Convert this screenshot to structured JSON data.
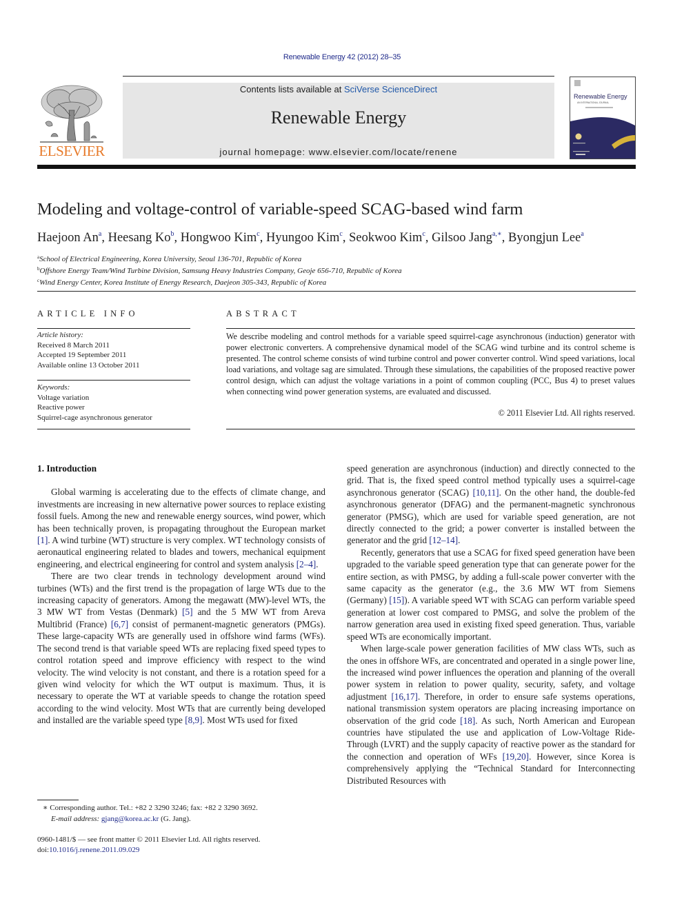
{
  "header": {
    "citation": "Renewable Energy 42 (2012) 28–35",
    "contents_prefix": "Contents lists available at ",
    "contents_link": "SciVerse ScienceDirect",
    "journal_name": "Renewable Energy",
    "homepage": "journal homepage: www.elsevier.com/locate/renene",
    "publisher_logo": "ELSEVIER",
    "cover": {
      "title": "Renewable Energy",
      "subtitle": "AN INTERNATIONAL JOURNAL"
    },
    "colors": {
      "link": "#1f2a8a",
      "elsevier_orange": "#e77a2a",
      "banner_gray": "#e6e6e6",
      "cover_navy": "#2b2a63",
      "cover_gold": "#d6b23a"
    }
  },
  "article": {
    "title": "Modeling and voltage-control of variable-speed SCAG-based wind farm",
    "authors": [
      {
        "name": "Haejoon An",
        "sup": "a"
      },
      {
        "name": "Heesang Ko",
        "sup": "b"
      },
      {
        "name": "Hongwoo Kim",
        "sup": "c"
      },
      {
        "name": "Hyungoo Kim",
        "sup": "c"
      },
      {
        "name": "Seokwoo Kim",
        "sup": "c"
      },
      {
        "name": "Gilsoo Jang",
        "sup": "a,∗"
      },
      {
        "name": "Byongjun Lee",
        "sup": "a"
      }
    ],
    "affiliations": [
      {
        "key": "a",
        "text": "School of Electrical Engineering, Korea University, Seoul 136-701, Republic of Korea"
      },
      {
        "key": "b",
        "text": "Offshore Energy Team/Wind Turbine Division, Samsung Heavy Industries Company, Geoje 656-710, Republic of Korea"
      },
      {
        "key": "c",
        "text": "Wind Energy Center, Korea Institute of Energy Research, Daejeon 305-343, Republic of Korea"
      }
    ]
  },
  "article_info": {
    "heading": "ARTICLE INFO",
    "history_label": "Article history:",
    "received": "Received 8 March 2011",
    "accepted": "Accepted 19 September 2011",
    "online": "Available online 13 October 2011",
    "keywords_label": "Keywords:",
    "keywords": [
      "Voltage variation",
      "Reactive power",
      "Squirrel-cage asynchronous generator"
    ]
  },
  "abstract": {
    "heading": "ABSTRACT",
    "text": "We describe modeling and control methods for a variable speed squirrel-cage asynchronous (induction) generator with power electronic converters. A comprehensive dynamical model of the SCAG wind turbine and its control scheme is presented. The control scheme consists of wind turbine control and power converter control. Wind speed variations, local load variations, and voltage sag are simulated. Through these simulations, the capabilities of the proposed reactive power control design, which can adjust the voltage variations in a point of common coupling (PCC, Bus 4) to preset values when connecting wind power generation systems, are evaluated and discussed.",
    "copyright": "© 2011 Elsevier Ltd. All rights reserved."
  },
  "body": {
    "section_heading": "1.  Introduction",
    "left": {
      "p1": [
        "Global warming is accelerating due to the effects of climate change, and investments are increasing in new alternative power sources to replace existing fossil fuels. Among the new and renewable energy sources, wind power, which has been technically proven, is propagating throughout the European market ",
        "[1]",
        ". A wind turbine (WT) structure is very complex. WT technology consists of aeronautical engineering related to blades and towers, mechanical equipment engineering, and electrical engineering for control and system analysis ",
        "[2–4]",
        "."
      ],
      "p2": [
        "There are two clear trends in technology development around wind turbines (WTs) and the first trend is the propagation of large WTs due to the increasing capacity of generators. Among the megawatt (MW)-level WTs, the 3 MW WT from Vestas (Denmark) ",
        "[5]",
        " and the 5 MW WT from Areva Multibrid (France) ",
        "[6,7]",
        " consist of permanent-magnetic generators (PMGs). These large-capacity WTs are generally used in offshore wind farms (WFs). The second trend is that variable speed WTs are replacing fixed speed types to control rotation speed and improve efficiency with respect to the wind velocity. The wind velocity is not constant, and there is a rotation speed for a given wind velocity for which the WT output is maximum. Thus, it is necessary to operate the WT at variable speeds to change the rotation speed according to the wind velocity. Most WTs that are currently being developed and installed are the variable speed type ",
        "[8,9]",
        ". Most WTs used for fixed"
      ]
    },
    "right": {
      "p0": [
        "speed generation are asynchronous (induction) and directly connected to the grid. That is, the fixed speed control method typically uses a squirrel-cage asynchronous generator (SCAG) ",
        "[10,11]",
        ". On the other hand, the double-fed asynchronous generator (DFAG) and the permanent-magnetic synchronous generator (PMSG), which are used for variable speed generation, are not directly connected to the grid; a power converter is installed between the generator and the grid ",
        "[12–14]",
        "."
      ],
      "p1": [
        "Recently, generators that use a SCAG for fixed speed generation have been upgraded to the variable speed generation type that can generate power for the entire section, as with PMSG, by adding a full-scale power converter with the same capacity as the generator (e.g., the 3.6 MW WT from Siemens (Germany) ",
        "[15]",
        "). A variable speed WT with SCAG can perform variable speed generation at lower cost compared to PMSG, and solve the problem of the narrow generation area used in existing fixed speed generation. Thus, variable speed WTs are economically important."
      ],
      "p2": [
        "When large-scale power generation facilities of MW class WTs, such as the ones in offshore WFs, are concentrated and operated in a single power line, the increased wind power influences the operation and planning of the overall power system in relation to power quality, security, safety, and voltage adjustment ",
        "[16,17]",
        ". Therefore, in order to ensure safe systems operations, national transmission system operators are placing increasing importance on observation of the grid code ",
        "[18]",
        ". As such, North American and European countries have stipulated the use and application of Low-Voltage Ride-Through (LVRT) and the supply capacity of reactive power as the standard for the connection and operation of WFs ",
        "[19,20]",
        ". However, since Korea is comprehensively applying the “Technical Standard for Interconnecting Distributed Resources with"
      ]
    }
  },
  "footnote": {
    "mark": "∗",
    "corresponding": " Corresponding author. Tel.: +82 2 3290 3246; fax: +82 2 3290 3692.",
    "email_label": "E-mail address: ",
    "email": "gjang@korea.ac.kr",
    "email_suffix": " (G. Jang)."
  },
  "frontmatter": {
    "issn_line": "0960-1481/$ — see front matter © 2011 Elsevier Ltd. All rights reserved.",
    "doi_prefix": "doi:",
    "doi": "10.1016/j.renene.2011.09.029"
  }
}
